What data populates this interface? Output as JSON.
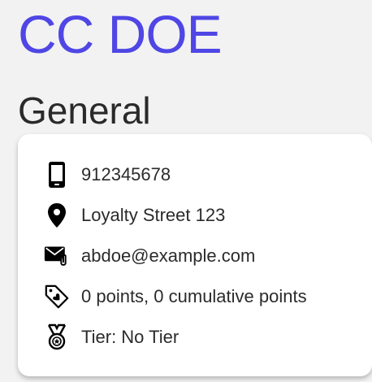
{
  "header": {
    "name": "CC DOE",
    "section_title": "General"
  },
  "details": {
    "phone": {
      "icon": "phone-icon",
      "value": "912345678"
    },
    "address": {
      "icon": "location-pin-icon",
      "value": "Loyalty Street 123"
    },
    "email": {
      "icon": "mail-attachment-icon",
      "value": "abdoe@example.com"
    },
    "points": {
      "icon": "tag-heart-icon",
      "value": "0 points, 0 cumulative points"
    },
    "tier": {
      "icon": "medal-icon",
      "value": "Tier: No Tier"
    }
  },
  "colors": {
    "accent": "#4f46e5",
    "background": "#f2f2f2",
    "card": "#ffffff"
  }
}
